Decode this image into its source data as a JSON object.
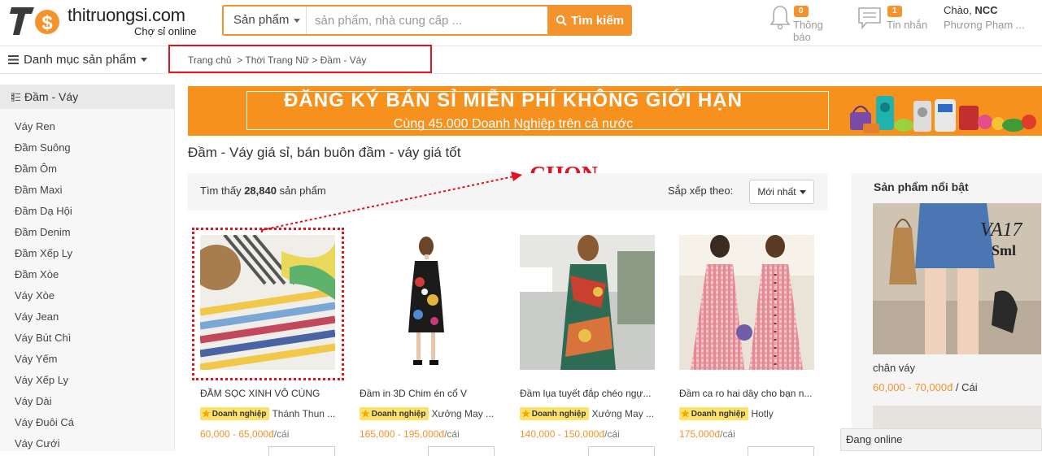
{
  "header": {
    "logo_text": "thitruongsi.com",
    "logo_sub": "Chợ sỉ online",
    "search_category": "Sản phẩm",
    "search_placeholder": "sản phẩm, nhà cung cấp ...",
    "search_button": "Tìm kiếm",
    "notifications": {
      "label": "Thông báo",
      "count": "0"
    },
    "messages": {
      "label": "Tin nhắn",
      "count": "1"
    },
    "greeting": "Chào,",
    "user_name": "NCC",
    "user_fullname": "Phương Phạm ..."
  },
  "nav": {
    "category_menu": "Danh mục sản phẩm",
    "breadcrumb": "Trang chủ  > Thời Trang Nữ > Đầm - Váy"
  },
  "sidebar": {
    "title": "Đầm - Váy",
    "items": [
      "Váy Ren",
      "Đầm Suông",
      "Đầm Ôm",
      "Đầm Maxi",
      "Đầm Dạ Hội",
      "Đầm Denim",
      "Đầm Xếp Ly",
      "Đầm Xòe",
      "Váy Xòe",
      "Váy Jean",
      "Váy Bút Chì",
      "Váy Yếm",
      "Váy Xếp Ly",
      "Váy Dài",
      "Váy Đuôi Cá",
      "Váy Cưới"
    ]
  },
  "banner": {
    "title": "ĐĂNG KÝ BÁN SỈ MIỄN PHÍ KHÔNG GIỚI HẠN",
    "subtitle": "Cùng 45.000 Doanh Nghiệp trên cả nước"
  },
  "page_title": "Đầm - Váy giá sỉ, bán buôn đầm - váy giá tốt",
  "annotation": "CHỌN",
  "results": {
    "prefix": "Tìm thấy",
    "count": "28,840",
    "suffix": "sản phẩm",
    "sort_label": "Sắp xếp theo:",
    "sort_value": "Mới nhất"
  },
  "products": [
    {
      "name": "ĐẦM SỌC XINH VÔ CÙNG",
      "badge": "Doanh nghiệp",
      "seller": "Thánh Thun ...",
      "price": "60,000 - 65,000đ",
      "unit": "/cái"
    },
    {
      "name": "Đầm in 3D Chim én cổ V",
      "badge": "Doanh nghiệp",
      "seller": "Xưởng May ...",
      "price": "165,000 - 195,000đ",
      "unit": "/cái"
    },
    {
      "name": "Đầm lụa tuyết đắp chéo ngự...",
      "badge": "Doanh nghiệp",
      "seller": "Xưởng May ...",
      "price": "140,000 - 150,000đ",
      "unit": "/cái"
    },
    {
      "name": "Đầm ca ro hai dây cho bạn n...",
      "badge": "Doanh nghiệp",
      "seller": "Hotly",
      "price": "175,000đ",
      "unit": "/cái"
    }
  ],
  "featured": {
    "title": "Sản phẩm nổi bật",
    "image_text_1": "VA17",
    "image_text_2": "Sml",
    "name": "chân váy",
    "price": "60,000 - 70,000đ",
    "unit": " / Cái"
  },
  "online_label": "Đang online",
  "colors": {
    "brand": "#f4932b",
    "highlight": "#e0141e"
  }
}
